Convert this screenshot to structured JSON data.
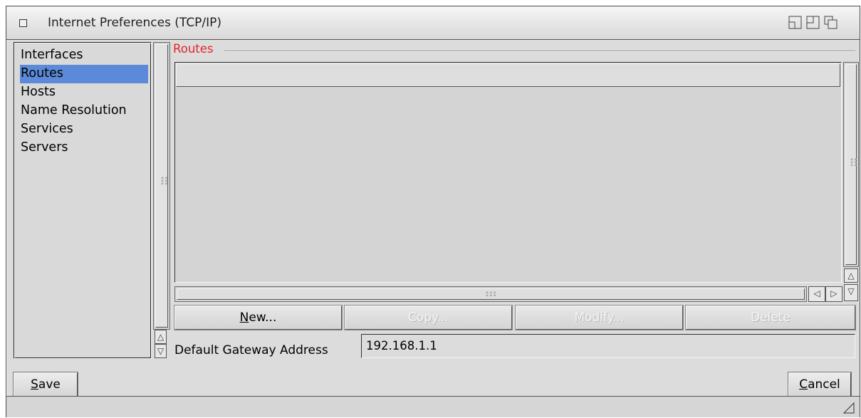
{
  "window": {
    "title": "Internet Preferences (TCP/IP)"
  },
  "sidebar": {
    "items": [
      {
        "label": "Interfaces"
      },
      {
        "label": "Routes",
        "selected": true
      },
      {
        "label": "Hosts"
      },
      {
        "label": "Name Resolution"
      },
      {
        "label": "Services"
      },
      {
        "label": "Servers"
      }
    ]
  },
  "routes": {
    "group_label": "Routes",
    "columns": [],
    "rows": [],
    "buttons": {
      "new": "New...",
      "new_key": "N",
      "new_rest": "ew...",
      "copy": "Copy...",
      "modify": "Modify...",
      "delete": "Delete"
    },
    "gateway_label": "Default Gateway Address",
    "gateway_value": "192.168.1.1"
  },
  "footer": {
    "save_key": "S",
    "save_rest": "ave",
    "cancel_key": "C",
    "cancel_rest": "ancel"
  },
  "colors": {
    "accent_selected": "#5c8ad8",
    "group_label": "#e3242b",
    "window_bg": "#dcdcdc"
  },
  "icons": [
    "close-gadget-icon",
    "iconify-icon",
    "zoom-icon",
    "depth-icon",
    "up-arrow-icon",
    "down-arrow-icon",
    "left-arrow-icon",
    "right-arrow-icon",
    "resize-grip-icon"
  ]
}
